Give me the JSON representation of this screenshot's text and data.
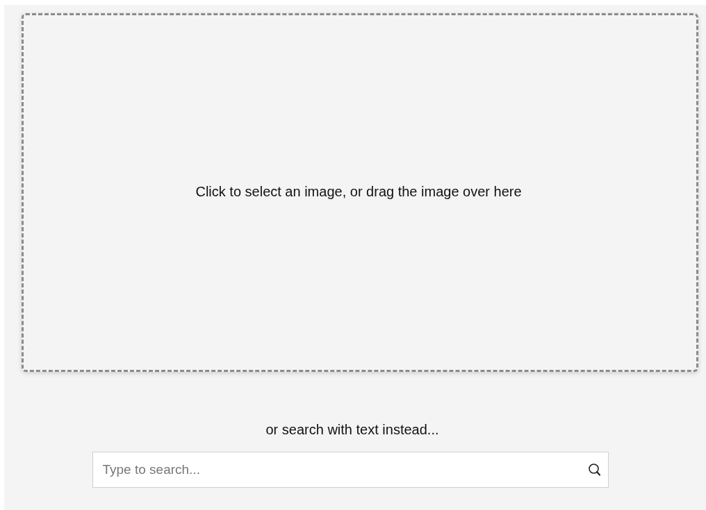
{
  "drop_zone": {
    "label": "Click to select an image, or drag the image over here"
  },
  "alt_text": "or search with text instead...",
  "search": {
    "placeholder": "Type to search..."
  }
}
